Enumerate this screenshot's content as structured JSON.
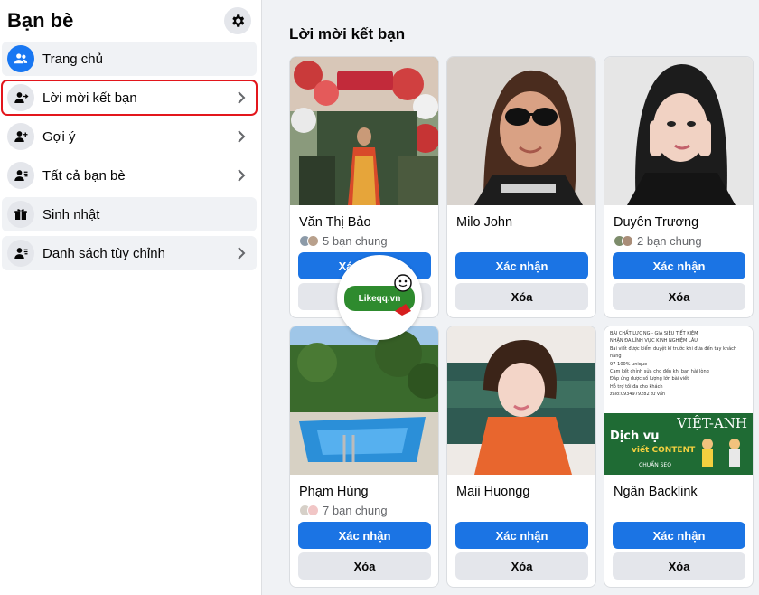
{
  "sidebar": {
    "title": "Bạn bè",
    "items": [
      {
        "label": "Trang chủ",
        "icon": "friends-icon"
      },
      {
        "label": "Lời mời kết bạn",
        "icon": "person-arrow-icon"
      },
      {
        "label": "Gợi ý",
        "icon": "person-plus-icon"
      },
      {
        "label": "Tất cả bạn bè",
        "icon": "person-list-icon"
      },
      {
        "label": "Sinh nhật",
        "icon": "gift-icon"
      },
      {
        "label": "Danh sách tùy chỉnh",
        "icon": "person-list-icon"
      }
    ]
  },
  "main": {
    "title": "Lời mời kết bạn",
    "cards": [
      {
        "name": "Văn Thị Bảo",
        "mutual": "5 bạn chung",
        "confirm": "Xác nhận",
        "delete": "Xóa"
      },
      {
        "name": "Milo John",
        "mutual": "",
        "confirm": "Xác nhận",
        "delete": "Xóa"
      },
      {
        "name": "Duyên Trương",
        "mutual": "2 bạn chung",
        "confirm": "Xác nhận",
        "delete": "Xóa"
      },
      {
        "name": "Phạm Hùng",
        "mutual": "7 bạn chung",
        "confirm": "Xác nhận",
        "delete": "Xóa"
      },
      {
        "name": "Maii Huongg",
        "mutual": "",
        "confirm": "Xác nhận",
        "delete": "Xóa"
      },
      {
        "name": "Ngân Backlink",
        "mutual": "",
        "confirm": "Xác nhận",
        "delete": "Xóa"
      }
    ]
  },
  "watermark": {
    "brand": "Likeqq.vn"
  },
  "ad_image": {
    "lines": [
      "BÀI CHẤT LƯỢNG - GIÁ SIÊU TIẾT KIỆM",
      "NHẬN ĐA LĨNH VỰC KINH NGHIỆM LÂU",
      "Bài viết được kiểm duyệt kĩ trước khi đưa đến tay khách hàng",
      "97-100% unique",
      "Cam kết chỉnh sửa cho đến khi bạn hài lòng",
      "Đáp ứng được số lượng lớn bài viết",
      "Hỗ trợ tối đa cho khách",
      "zalo:0934979282 tư vấn"
    ],
    "headline": "VIỆT-ANH",
    "service": "Dịch vụ",
    "service2": "viết CONTENT",
    "tag": "CHUẨN SEO"
  },
  "colors": {
    "accent": "#1b74e4",
    "highlight": "#e3161c"
  }
}
